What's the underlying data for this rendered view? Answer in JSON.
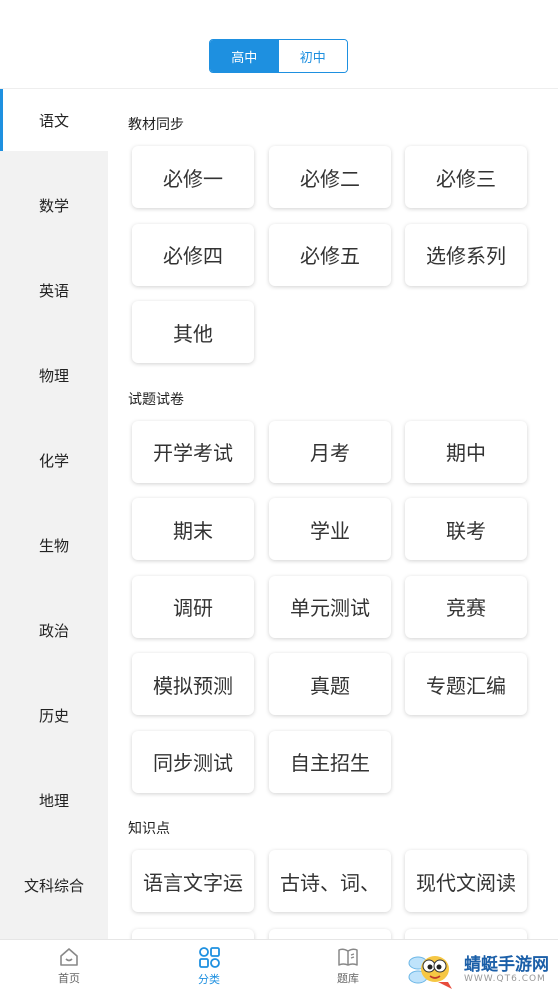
{
  "segment": {
    "options": [
      "高中",
      "初中"
    ],
    "selected": 0
  },
  "sidebar": {
    "items": [
      "语文",
      "数学",
      "英语",
      "物理",
      "化学",
      "生物",
      "政治",
      "历史",
      "地理",
      "文科综合"
    ],
    "active": 0
  },
  "sections": [
    {
      "title": "教材同步",
      "items": [
        "必修一",
        "必修二",
        "必修三",
        "必修四",
        "必修五",
        "选修系列",
        "其他"
      ]
    },
    {
      "title": "试题试卷",
      "items": [
        "开学考试",
        "月考",
        "期中",
        "期末",
        "学业",
        "联考",
        "调研",
        "单元测试",
        "竞赛",
        "模拟预测",
        "真题",
        "专题汇编",
        "同步测试",
        "自主招生"
      ]
    },
    {
      "title": "知识点",
      "items": [
        "语言文字运",
        "古诗、词、",
        "现代文阅读"
      ]
    }
  ],
  "tabbar": {
    "tabs": [
      {
        "label": "首页",
        "icon": "home-icon"
      },
      {
        "label": "分类",
        "icon": "category-icon"
      },
      {
        "label": "题库",
        "icon": "book-icon"
      }
    ],
    "active": 1
  },
  "watermark": {
    "name": "蜻蜓手游网",
    "url": "WWW.QT6.COM"
  },
  "colors": {
    "accent": "#1e90e0",
    "sidebar_bg": "#f2f2f2"
  }
}
